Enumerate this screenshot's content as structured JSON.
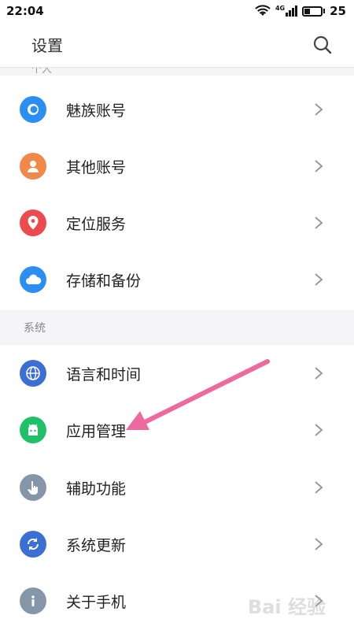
{
  "status_bar": {
    "time": "22:04",
    "network": "4G",
    "battery": "25"
  },
  "header": {
    "title": "设置"
  },
  "sections": {
    "personal": {
      "partial_label": "个人",
      "items": [
        {
          "label": "魅族账号",
          "icon": "account-icon",
          "color": "#2b8ef3"
        },
        {
          "label": "其他账号",
          "icon": "person-icon",
          "color": "#f2894b"
        },
        {
          "label": "定位服务",
          "icon": "location-icon",
          "color": "#ec4a4f"
        },
        {
          "label": "存储和备份",
          "icon": "cloud-icon",
          "color": "#2b8ef3"
        }
      ]
    },
    "system": {
      "label": "系统",
      "items": [
        {
          "label": "语言和时间",
          "icon": "globe-icon",
          "color": "#3b6fd3"
        },
        {
          "label": "应用管理",
          "icon": "android-icon",
          "color": "#1fc06a"
        },
        {
          "label": "辅助功能",
          "icon": "hand-icon",
          "color": "#8596a8"
        },
        {
          "label": "系统更新",
          "icon": "refresh-icon",
          "color": "#3b6fd3"
        },
        {
          "label": "关于手机",
          "icon": "info-icon",
          "color": "#8596a8"
        }
      ]
    }
  },
  "annotation": {
    "arrow_color": "#ee6a9e"
  },
  "watermark": "Bai 经验"
}
